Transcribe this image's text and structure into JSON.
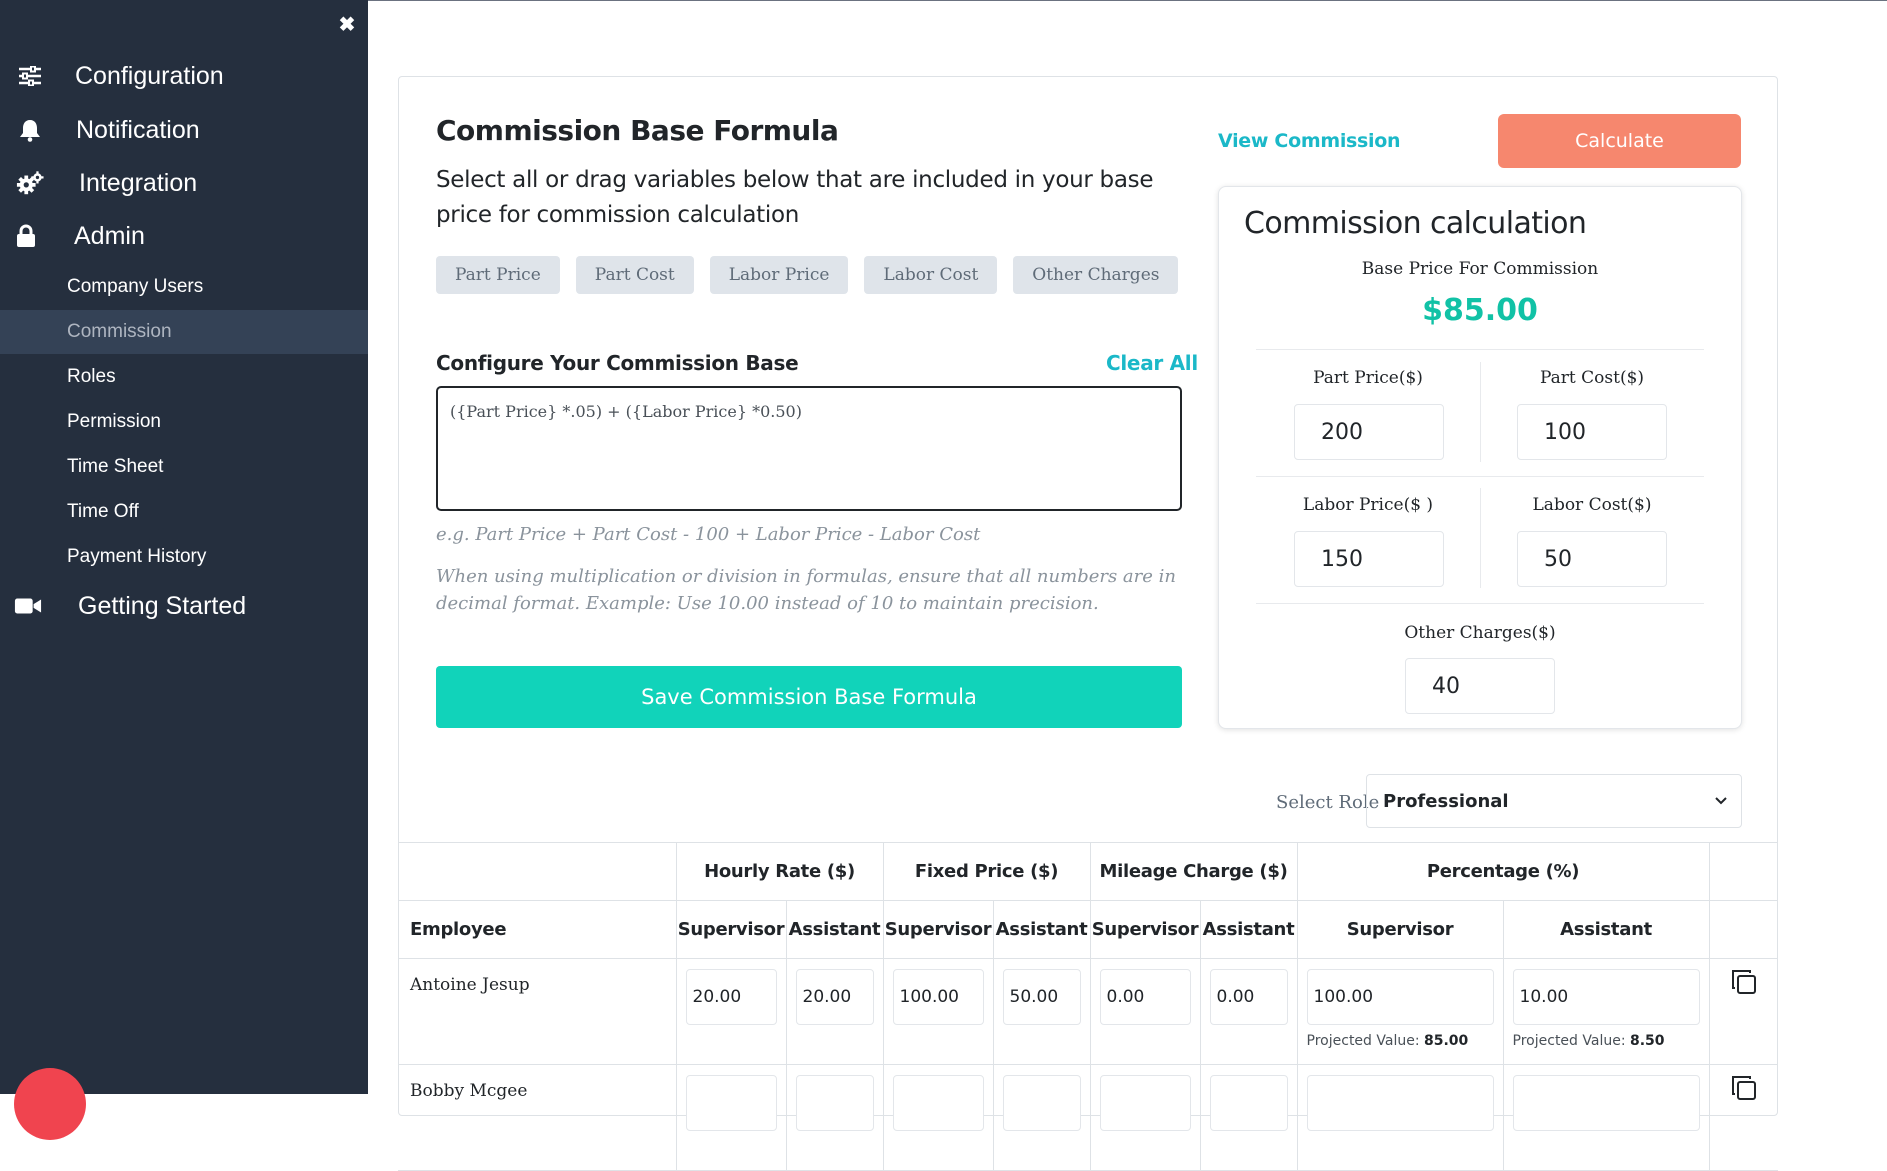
{
  "sidebar": {
    "close_glyph": "✖",
    "main_items": [
      {
        "label": "Configuration",
        "icon": "sliders-icon"
      },
      {
        "label": "Notification",
        "icon": "bell-icon"
      },
      {
        "label": "Integration",
        "icon": "gears-icon"
      },
      {
        "label": "Admin",
        "icon": "lock-icon"
      },
      {
        "label": "Getting Started",
        "icon": "video-camera-icon"
      }
    ],
    "sub_items": [
      {
        "label": "Company Users",
        "active": false
      },
      {
        "label": "Commission",
        "active": true
      },
      {
        "label": "Roles",
        "active": false
      },
      {
        "label": "Permission",
        "active": false
      },
      {
        "label": "Time Sheet",
        "active": false
      },
      {
        "label": "Time Off",
        "active": false
      },
      {
        "label": "Payment History",
        "active": false
      }
    ]
  },
  "formula": {
    "title": "Commission Base Formula",
    "description": "Select all or drag variables below that are included in your base price for commission calculation",
    "variables": [
      "Part Price",
      "Part Cost",
      "Labor Price",
      "Labor Cost",
      "Other Charges"
    ],
    "configure_label": "Configure Your Commission Base",
    "clear_all": "Clear All",
    "value": "({Part Price} *.05) + ({Labor Price} *0.50)",
    "example_hint": "e.g. Part Price + Part Cost - 100 + Labor Price - Labor Cost",
    "decimal_hint": "When using multiplication or division in formulas, ensure that all numbers are in decimal format. Example: Use 10.00 instead of 10 to maintain precision.",
    "save_label": "Save Commission Base Formula"
  },
  "actions": {
    "view_commission": "View Commission",
    "calculate": "Calculate"
  },
  "calculation": {
    "title": "Commission calculation",
    "base_price_label": "Base Price For Commission",
    "base_price_value": "$85.00",
    "part_price_label": "Part Price($)",
    "part_price_value": "200",
    "part_cost_label": "Part Cost($)",
    "part_cost_value": "100",
    "labor_price_label": "Labor Price($ )",
    "labor_price_value": "150",
    "labor_cost_label": "Labor Cost($)",
    "labor_cost_value": "50",
    "other_charges_label": "Other Charges($)",
    "other_charges_value": "40"
  },
  "role": {
    "label": "Select Role",
    "selected": "Professional"
  },
  "table": {
    "employee_header": "Employee",
    "groups": [
      "Hourly Rate ($)",
      "Fixed Price ($)",
      "Mileage Charge ($)",
      "Percentage (%)"
    ],
    "sub_headers": [
      "Supervisor",
      "Assistant",
      "Supervisor",
      "Assistant",
      "Supervisor",
      "Assistant",
      "Supervisor",
      "Assistant"
    ],
    "projected_label": "Projected Value:",
    "rows": [
      {
        "name": "Antoine Jesup",
        "values": [
          "20.00",
          "20.00",
          "100.00",
          "50.00",
          "0.00",
          "0.00",
          "100.00",
          "10.00"
        ],
        "projected_supervisor": "85.00",
        "projected_assistant": "8.50"
      },
      {
        "name": "Bobby Mcgee",
        "values": [
          "",
          "",
          "",
          "",
          "",
          "",
          "",
          ""
        ],
        "projected_supervisor": "",
        "projected_assistant": ""
      }
    ]
  },
  "colors": {
    "sidebar_bg": "#252f3e",
    "active_item_bg": "#344256",
    "accent_teal": "#11d3ba",
    "link_cyan": "#1bb8c8",
    "calculate_salmon": "#f6876e",
    "price_green": "#11c2a6"
  }
}
